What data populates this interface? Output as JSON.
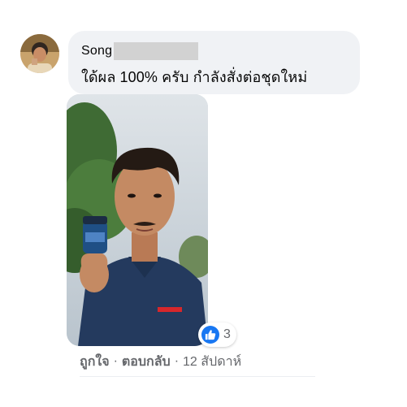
{
  "comment": {
    "author_name": "Song",
    "text": "ใด้ผล 100% ครับ กำลังสั่งต่อชุดใหม่",
    "reaction_count": "3"
  },
  "actions": {
    "like_label": "ถูกใจ",
    "reply_label": "ตอบกลับ",
    "separator": "·",
    "timestamp": "12 สัปดาห์"
  },
  "icons": {
    "avatar": "avatar",
    "photo": "photo-attachment",
    "reaction": "thumbs-up-icon"
  },
  "colors": {
    "bubble": "#f0f2f5",
    "like_blue": "#1877f2",
    "secondary_text": "#65676b"
  }
}
